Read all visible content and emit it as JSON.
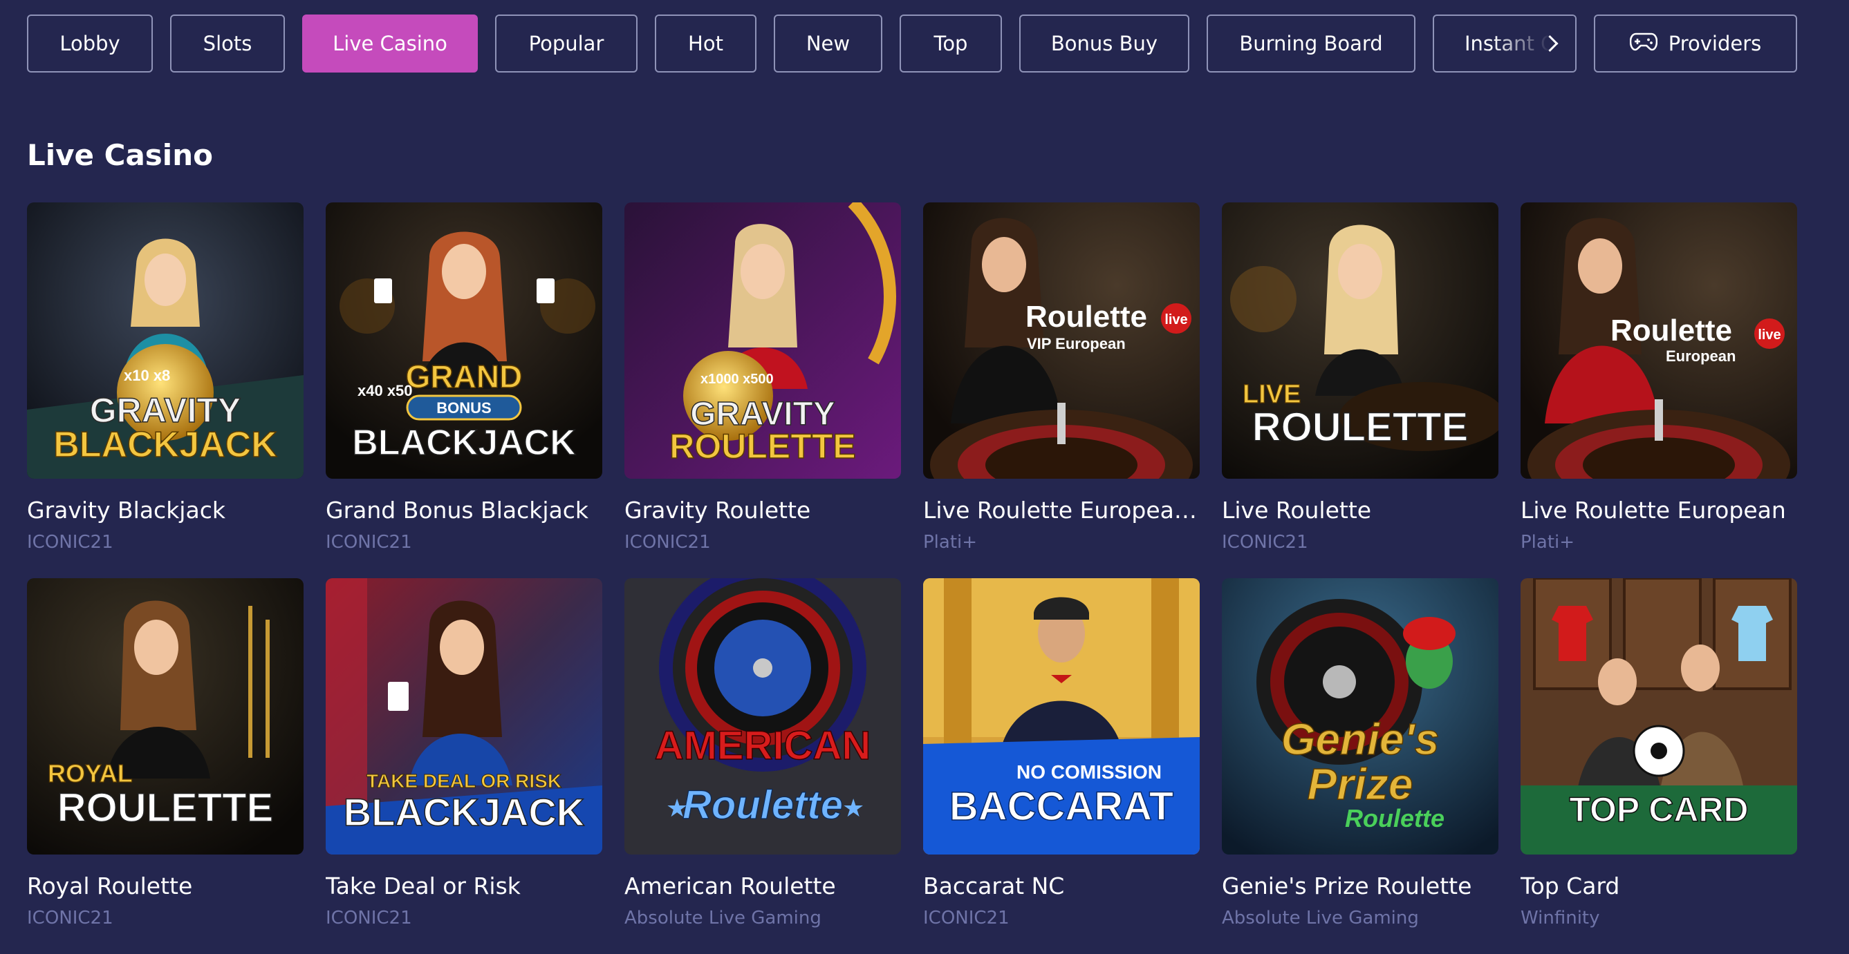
{
  "tabs": [
    {
      "label": "Lobby",
      "active": false
    },
    {
      "label": "Slots",
      "active": false
    },
    {
      "label": "Live Casino",
      "active": true
    },
    {
      "label": "Popular",
      "active": false
    },
    {
      "label": "Hot",
      "active": false
    },
    {
      "label": "New",
      "active": false
    },
    {
      "label": "Top",
      "active": false
    },
    {
      "label": "Bonus Buy",
      "active": false
    },
    {
      "label": "Burning Board",
      "active": false
    },
    {
      "label": "Instant G",
      "active": false
    }
  ],
  "providers_button": {
    "label": "Providers",
    "icon": "gamepad-icon"
  },
  "scroll_icon": "chevron-right-icon",
  "section": {
    "title": "Live Casino"
  },
  "games": [
    {
      "title": "Gravity Blackjack",
      "provider": "ICONIC21",
      "art": {
        "line1": "GRAVITY",
        "line2": "BLACKJACK",
        "extra": "x10 x8"
      }
    },
    {
      "title": "Grand Bonus Blackjack",
      "provider": "ICONIC21",
      "art": {
        "line1": "GRAND",
        "line2": "BLACKJACK",
        "badge": "BONUS",
        "extra": "x40 x50"
      }
    },
    {
      "title": "Gravity Roulette",
      "provider": "ICONIC21",
      "art": {
        "line1": "GRAVITY",
        "line2": "ROULETTE",
        "extra": "x1000 x500"
      }
    },
    {
      "title": "Live Roulette European ...",
      "provider": "Plati+",
      "art": {
        "line1": "Roulette",
        "badge": "live",
        "sub": "VIP European"
      }
    },
    {
      "title": "Live Roulette",
      "provider": "ICONIC21",
      "art": {
        "line1": "LIVE",
        "line2": "ROULETTE"
      }
    },
    {
      "title": "Live Roulette European",
      "provider": "Plati+",
      "art": {
        "line1": "Roulette",
        "badge": "live",
        "sub": "European"
      }
    },
    {
      "title": "Royal Roulette",
      "provider": "ICONIC21",
      "art": {
        "line1": "ROYAL",
        "line2": "ROULETTE"
      }
    },
    {
      "title": "Take Deal or Risk",
      "provider": "ICONIC21",
      "art": {
        "line1": "TAKE DEAL OR RISK",
        "line2": "BLACKJACK"
      }
    },
    {
      "title": "American Roulette",
      "provider": "Absolute Live Gaming",
      "art": {
        "line1": "AMERICAN",
        "line2": "Roulette"
      }
    },
    {
      "title": "Baccarat NC",
      "provider": "ICONIC21",
      "art": {
        "line1": "NO COMISSION",
        "line2": "BACCARAT"
      }
    },
    {
      "title": "Genie's Prize Roulette",
      "provider": "Absolute Live Gaming",
      "art": {
        "line1": "Genie's",
        "line2": "Prize",
        "sub": "Roulette"
      }
    },
    {
      "title": "Top Card",
      "provider": "Winfinity",
      "art": {
        "line1": "TOP CARD"
      }
    }
  ],
  "colors": {
    "background": "#24264f",
    "active_tab": "#c54bbc",
    "tab_border": "#8f93b8",
    "provider_text": "#6f74a8",
    "gold": "#f3c640"
  }
}
